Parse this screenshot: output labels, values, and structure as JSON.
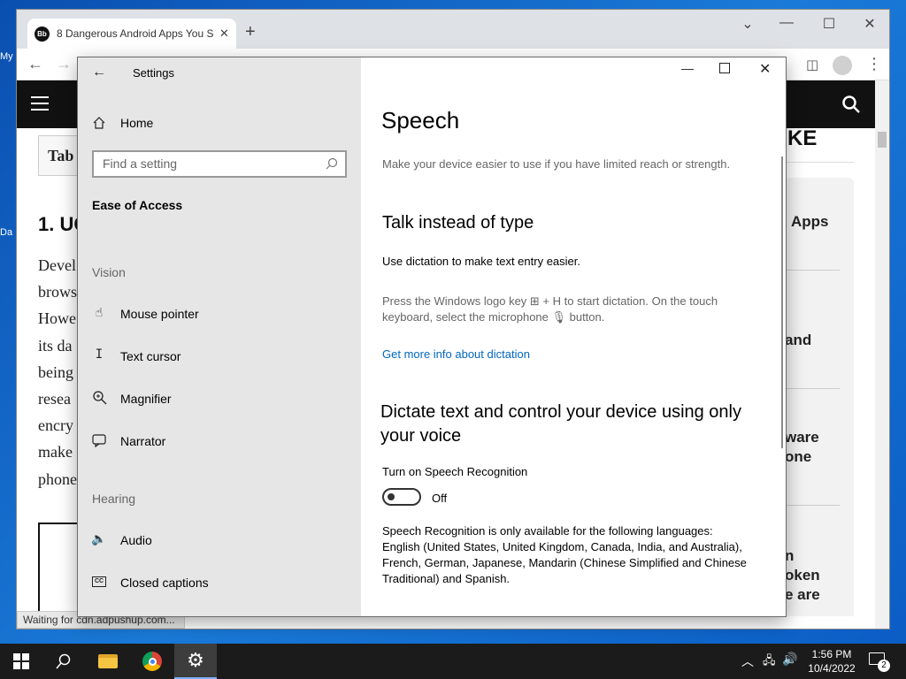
{
  "desktop": {
    "labels": [
      "My",
      "Da"
    ]
  },
  "browser": {
    "tab_title": "8 Dangerous Android Apps You S",
    "tab_favicon": "Bb",
    "status": "Waiting for cdn.adpushup.com...",
    "page": {
      "left_heading_fragment": "Tab",
      "section_heading": "1. UC",
      "body_lines": [
        "Devel",
        "brows",
        "Howe",
        "its da",
        "being",
        "resea",
        "encry",
        "make",
        "phone"
      ],
      "right_heading_fragment": "KE",
      "right_items": [
        "Apps",
        "and",
        "ware",
        "one",
        "n",
        "oken",
        "e are"
      ]
    }
  },
  "settings": {
    "window_title": "Settings",
    "sidebar": {
      "home_label": "Home",
      "search_placeholder": "Find a setting",
      "category": "Ease of Access",
      "vision_header": "Vision",
      "vision_items": [
        "Mouse pointer",
        "Text cursor",
        "Magnifier",
        "Narrator"
      ],
      "hearing_header": "Hearing",
      "hearing_items": [
        "Audio",
        "Closed captions"
      ]
    },
    "main": {
      "title": "Speech",
      "subtitle": "Make your device easier to use if you have limited reach or strength.",
      "talk_heading": "Talk instead of type",
      "talk_desc": "Use dictation to make text entry easier.",
      "dictation_hint_1": "Press the Windows logo key ⊞ + H to start dictation.  On the touch",
      "dictation_hint_2": "keyboard, select the microphone 🎙 button.",
      "dictation_link": "Get more info about dictation",
      "dictate_heading_1": "Dictate text and control your device using only",
      "dictate_heading_2": "your voice",
      "toggle_label": "Turn on Speech Recognition",
      "toggle_state": "Off",
      "languages_1": "Speech Recognition is only available for the following languages:",
      "languages_2": "English (United States, United Kingdom, Canada, India, and Australia),",
      "languages_3": "French, German, Japanese, Mandarin (Chinese Simplified and Chinese",
      "languages_4": "Traditional) and Spanish."
    }
  },
  "taskbar": {
    "time": "1:56 PM",
    "date": "10/4/2022",
    "notification_count": "2"
  },
  "colors": {
    "accent": "#0067c0",
    "taskbar": "#1b1b1b",
    "sidebar": "#e6e6e6"
  }
}
